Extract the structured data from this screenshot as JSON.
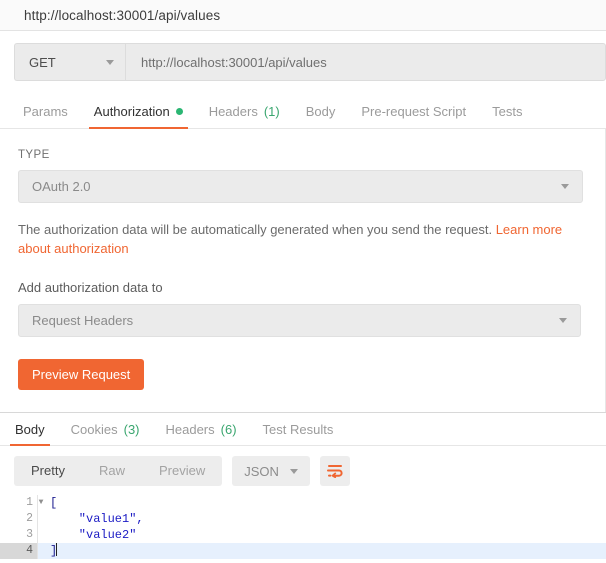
{
  "window": {
    "title": "http://localhost:30001/api/values"
  },
  "request": {
    "method": "GET",
    "url": "http://localhost:30001/api/values",
    "tabs": [
      {
        "label": "Params",
        "count": "",
        "dot": false,
        "active": false
      },
      {
        "label": "Authorization",
        "count": "",
        "dot": true,
        "active": true
      },
      {
        "label": "Headers",
        "count": "(1)",
        "dot": false,
        "active": false
      },
      {
        "label": "Body",
        "count": "",
        "dot": false,
        "active": false
      },
      {
        "label": "Pre-request Script",
        "count": "",
        "dot": false,
        "active": false
      },
      {
        "label": "Tests",
        "count": "",
        "dot": false,
        "active": false
      }
    ]
  },
  "authorization": {
    "type_label": "TYPE",
    "type_value": "OAuth 2.0",
    "help_text": "The authorization data will be automatically generated when you send the request. ",
    "help_link": "Learn more about authorization",
    "add_to_label": "Add authorization data to",
    "add_to_value": "Request Headers",
    "preview_button": "Preview Request"
  },
  "response": {
    "tabs": [
      {
        "label": "Body",
        "count": "",
        "active": true
      },
      {
        "label": "Cookies",
        "count": "(3)",
        "active": false
      },
      {
        "label": "Headers",
        "count": "(6)",
        "active": false
      },
      {
        "label": "Test Results",
        "count": "",
        "active": false
      }
    ],
    "view_modes": [
      {
        "label": "Pretty",
        "active": true
      },
      {
        "label": "Raw",
        "active": false
      },
      {
        "label": "Preview",
        "active": false
      }
    ],
    "format": "JSON",
    "body_lines": [
      {
        "number": "1",
        "text": "[",
        "fold": true,
        "active": false,
        "punct": true
      },
      {
        "number": "2",
        "text": "    \"value1\",",
        "fold": false,
        "active": false,
        "punct": false
      },
      {
        "number": "3",
        "text": "    \"value2\"",
        "fold": false,
        "active": false,
        "punct": false
      },
      {
        "number": "4",
        "text": "]",
        "fold": false,
        "active": true,
        "punct": true
      }
    ]
  },
  "colors": {
    "accent": "#f06632",
    "dot_green": "#2bb673",
    "count_green": "#3aa66f",
    "json_string": "#1b1bc4"
  }
}
